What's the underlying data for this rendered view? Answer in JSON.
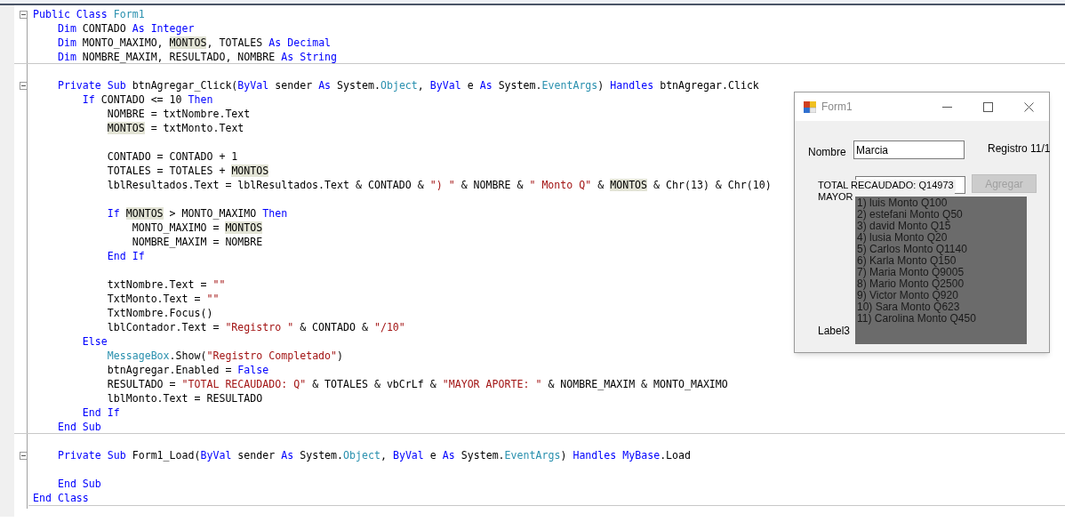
{
  "editor": {
    "lines": [
      {
        "fold": true,
        "separator": false,
        "tokens": [
          {
            "kind": "keyword",
            "text": "Public Class "
          },
          {
            "kind": "type",
            "text": "Form1"
          }
        ]
      },
      {
        "fold": false,
        "separator": false,
        "tokens": [
          {
            "kind": "keyword",
            "text": "    Dim"
          },
          {
            "kind": "plain",
            "text": " CONTADO "
          },
          {
            "kind": "keyword",
            "text": "As Integer"
          }
        ]
      },
      {
        "fold": false,
        "separator": false,
        "tokens": [
          {
            "kind": "keyword",
            "text": "    Dim"
          },
          {
            "kind": "plain",
            "text": " MONTO_MAXIMO, "
          },
          {
            "kind": "highlight",
            "text": "MONTOS"
          },
          {
            "kind": "plain",
            "text": ", TOTALES "
          },
          {
            "kind": "keyword",
            "text": "As Decimal"
          }
        ]
      },
      {
        "fold": false,
        "separator": true,
        "tokens": [
          {
            "kind": "keyword",
            "text": "    Dim"
          },
          {
            "kind": "plain",
            "text": " NOMBRE_MAXIM, RESULTADO, NOMBRE "
          },
          {
            "kind": "keyword",
            "text": "As String"
          }
        ]
      },
      {
        "fold": false,
        "separator": false
      },
      {
        "fold": true,
        "separator": false,
        "tokens": [
          {
            "kind": "keyword",
            "text": "    Private Sub"
          },
          {
            "kind": "plain",
            "text": " btnAgregar_Click("
          },
          {
            "kind": "keyword",
            "text": "ByVal"
          },
          {
            "kind": "plain",
            "text": " sender "
          },
          {
            "kind": "keyword",
            "text": "As"
          },
          {
            "kind": "plain",
            "text": " System."
          },
          {
            "kind": "type",
            "text": "Object"
          },
          {
            "kind": "plain",
            "text": ", "
          },
          {
            "kind": "keyword",
            "text": "ByVal"
          },
          {
            "kind": "plain",
            "text": " e "
          },
          {
            "kind": "keyword",
            "text": "As"
          },
          {
            "kind": "plain",
            "text": " System."
          },
          {
            "kind": "type",
            "text": "EventArgs"
          },
          {
            "kind": "plain",
            "text": ") "
          },
          {
            "kind": "keyword",
            "text": "Handles"
          },
          {
            "kind": "plain",
            "text": " btnAgregar.Click"
          }
        ]
      },
      {
        "fold": false,
        "separator": false,
        "tokens": [
          {
            "kind": "keyword",
            "text": "        If"
          },
          {
            "kind": "plain",
            "text": " CONTADO <= 10 "
          },
          {
            "kind": "keyword",
            "text": "Then"
          }
        ]
      },
      {
        "fold": false,
        "separator": false,
        "tokens": [
          {
            "kind": "plain",
            "text": "            NOMBRE = txtNombre.Text"
          }
        ]
      },
      {
        "fold": false,
        "separator": false,
        "tokens": [
          {
            "kind": "highlight",
            "text": "            MONTOS"
          },
          {
            "kind": "plain",
            "text": " = txtMonto.Text"
          }
        ]
      },
      {
        "fold": false,
        "separator": false
      },
      {
        "fold": false,
        "separator": false,
        "tokens": [
          {
            "kind": "plain",
            "text": "            CONTADO = CONTADO + 1"
          }
        ]
      },
      {
        "fold": false,
        "separator": false,
        "tokens": [
          {
            "kind": "plain",
            "text": "            TOTALES = TOTALES + "
          },
          {
            "kind": "highlight",
            "text": "MONTOS"
          }
        ]
      },
      {
        "fold": false,
        "separator": false,
        "tokens": [
          {
            "kind": "plain",
            "text": "            lblResultados.Text = lblResultados.Text & CONTADO & "
          },
          {
            "kind": "string",
            "text": "\") \""
          },
          {
            "kind": "plain",
            "text": " & NOMBRE & "
          },
          {
            "kind": "string",
            "text": "\" Monto Q\""
          },
          {
            "kind": "plain",
            "text": " & "
          },
          {
            "kind": "highlight",
            "text": "MONTOS"
          },
          {
            "kind": "plain",
            "text": " & Chr(13) & Chr(10)"
          }
        ]
      },
      {
        "fold": false,
        "separator": false
      },
      {
        "fold": false,
        "separator": false,
        "tokens": [
          {
            "kind": "keyword",
            "text": "            If "
          },
          {
            "kind": "highlight",
            "text": "MONTOS"
          },
          {
            "kind": "plain",
            "text": " > MONTO_MAXIMO "
          },
          {
            "kind": "keyword",
            "text": "Then"
          }
        ]
      },
      {
        "fold": false,
        "separator": false,
        "tokens": [
          {
            "kind": "plain",
            "text": "                MONTO_MAXIMO = "
          },
          {
            "kind": "highlight",
            "text": "MONTOS"
          }
        ]
      },
      {
        "fold": false,
        "separator": false,
        "tokens": [
          {
            "kind": "plain",
            "text": "                NOMBRE_MAXIM = NOMBRE"
          }
        ]
      },
      {
        "fold": false,
        "separator": false,
        "tokens": [
          {
            "kind": "keyword",
            "text": "            End If"
          }
        ]
      },
      {
        "fold": false,
        "separator": false
      },
      {
        "fold": false,
        "separator": false,
        "tokens": [
          {
            "kind": "plain",
            "text": "            txtNombre.Text = "
          },
          {
            "kind": "string",
            "text": "\"\""
          }
        ]
      },
      {
        "fold": false,
        "separator": false,
        "tokens": [
          {
            "kind": "plain",
            "text": "            TxtMonto.Text = "
          },
          {
            "kind": "string",
            "text": "\"\""
          }
        ]
      },
      {
        "fold": false,
        "separator": false,
        "tokens": [
          {
            "kind": "plain",
            "text": "            TxtNombre.Focus()"
          }
        ]
      },
      {
        "fold": false,
        "separator": false,
        "tokens": [
          {
            "kind": "plain",
            "text": "            lblContador.Text = "
          },
          {
            "kind": "string",
            "text": "\"Registro \""
          },
          {
            "kind": "plain",
            "text": " & CONTADO & "
          },
          {
            "kind": "string",
            "text": "\"/10\""
          }
        ]
      },
      {
        "fold": false,
        "separator": false,
        "tokens": [
          {
            "kind": "keyword",
            "text": "        Else"
          }
        ]
      },
      {
        "fold": false,
        "separator": false,
        "tokens": [
          {
            "kind": "type",
            "text": "            MessageBox"
          },
          {
            "kind": "plain",
            "text": ".Show("
          },
          {
            "kind": "string",
            "text": "\"Registro Completado\""
          },
          {
            "kind": "plain",
            "text": ")"
          }
        ]
      },
      {
        "fold": false,
        "separator": false,
        "tokens": [
          {
            "kind": "plain",
            "text": "            btnAgregar.Enabled = "
          },
          {
            "kind": "keyword",
            "text": "False"
          }
        ]
      },
      {
        "fold": false,
        "separator": false,
        "tokens": [
          {
            "kind": "plain",
            "text": "            RESULTADO = "
          },
          {
            "kind": "string",
            "text": "\"TOTAL RECAUDADO: Q\""
          },
          {
            "kind": "plain",
            "text": " & TOTALES & vbCrLf & "
          },
          {
            "kind": "string",
            "text": "\"MAYOR APORTE: \""
          },
          {
            "kind": "plain",
            "text": " & NOMBRE_MAXIM & MONTO_MAXIMO"
          }
        ]
      },
      {
        "fold": false,
        "separator": false,
        "tokens": [
          {
            "kind": "plain",
            "text": "            lblMonto.Text = RESULTADO"
          }
        ]
      },
      {
        "fold": false,
        "separator": false,
        "tokens": [
          {
            "kind": "keyword",
            "text": "        End If"
          }
        ]
      },
      {
        "fold": false,
        "separator": true,
        "tokens": [
          {
            "kind": "keyword",
            "text": "    End Sub"
          }
        ]
      },
      {
        "fold": false,
        "separator": false
      },
      {
        "fold": true,
        "separator": false,
        "tokens": [
          {
            "kind": "keyword",
            "text": "    Private Sub"
          },
          {
            "kind": "plain",
            "text": " Form1_Load("
          },
          {
            "kind": "keyword",
            "text": "ByVal"
          },
          {
            "kind": "plain",
            "text": " sender "
          },
          {
            "kind": "keyword",
            "text": "As"
          },
          {
            "kind": "plain",
            "text": " System."
          },
          {
            "kind": "type",
            "text": "Object"
          },
          {
            "kind": "plain",
            "text": ", "
          },
          {
            "kind": "keyword",
            "text": "ByVal"
          },
          {
            "kind": "plain",
            "text": " e "
          },
          {
            "kind": "keyword",
            "text": "As"
          },
          {
            "kind": "plain",
            "text": " System."
          },
          {
            "kind": "type",
            "text": "EventArgs"
          },
          {
            "kind": "plain",
            "text": ") "
          },
          {
            "kind": "keyword",
            "text": "Handles "
          },
          {
            "kind": "keyword",
            "text": "MyBase"
          },
          {
            "kind": "plain",
            "text": ".Load"
          }
        ]
      },
      {
        "fold": false,
        "separator": false
      },
      {
        "fold": false,
        "separator": false,
        "tokens": [
          {
            "kind": "keyword",
            "text": "    End Sub"
          }
        ]
      },
      {
        "fold": false,
        "separator": false,
        "tokens": [
          {
            "kind": "keyword",
            "text": "End Class"
          }
        ]
      }
    ]
  },
  "form": {
    "title": "Form1",
    "name_label": "Nombre",
    "name_value": "Marcia",
    "counter": "Registro 11/1",
    "add_button": {
      "label": "Agregar",
      "disabled": true
    },
    "result_lines": [
      "TOTAL RECAUDADO: Q14973",
      "MAYOR"
    ],
    "results": [
      "1) luis Monto Q100",
      "2) estefani Monto Q50",
      "3) david Monto Q15",
      "4) lusia Monto Q20",
      "5) Carlos Monto Q1140",
      "6) Karla Monto Q150",
      "7) Maria Monto Q9005",
      "8) Mario Monto Q2500",
      "9) Victor Monto Q920",
      "10) Sara Monto Q623",
      "11) Carolina Monto Q450"
    ],
    "label3": "Label3"
  }
}
